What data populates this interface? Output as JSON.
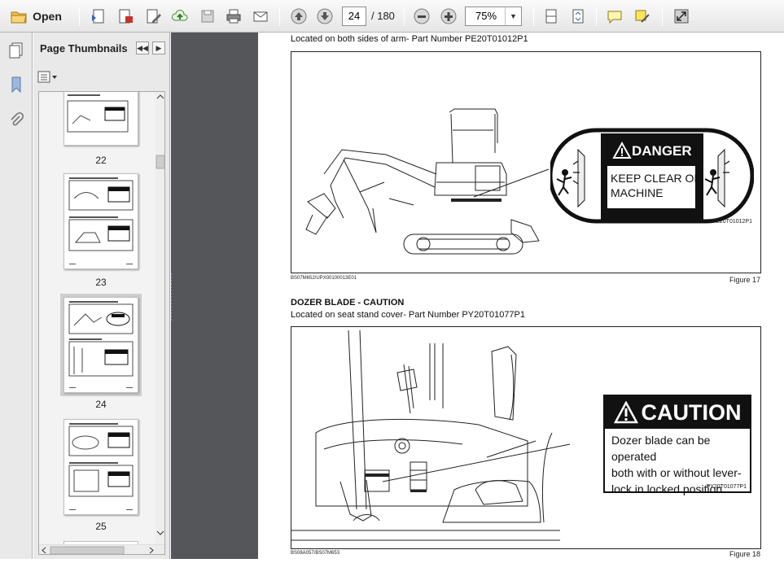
{
  "toolbar": {
    "open_label": "Open",
    "current_page": "24",
    "page_total": "/ 180",
    "zoom": "75%",
    "zoom_arrow": "▼"
  },
  "thumbnail_pane": {
    "title": "Page Thumbnails",
    "nav_back": "◀◀",
    "nav_forward": "▶",
    "thumbnails": [
      {
        "page": "22"
      },
      {
        "page": "23"
      },
      {
        "page": "24",
        "selected": true
      },
      {
        "page": "25"
      }
    ]
  },
  "document": {
    "fig17_caption": "Located on both sides of arm- Part Number PE20T01012P1",
    "fig17_danger_title": "DANGER",
    "fig17_danger_line1": "KEEP CLEAR OF",
    "fig17_danger_line2": "MACHINE",
    "fig17_part_code": "PE20T01012P1",
    "fig17_ref": "BS07M652/UPX00100013E01",
    "fig17_label": "Figure 17",
    "fig18_heading": "DOZER BLADE - CAUTION",
    "fig18_caption": "Located on seat stand cover- Part Number PY20T01077P1",
    "fig18_caution_title": "CAUTION",
    "fig18_caution_line1": "Dozer blade can be operated",
    "fig18_caution_line2": "both with or without lever-",
    "fig18_caution_line3": "lock in locked position.",
    "fig18_part_code": "PY20T01077P1",
    "fig18_ref": "BS08A057/BS07M653",
    "fig18_label": "Figure 18"
  },
  "colors": {
    "gutter": "#555659",
    "toolbar_bg": "#e6e6e6",
    "label_black": "#111111"
  }
}
